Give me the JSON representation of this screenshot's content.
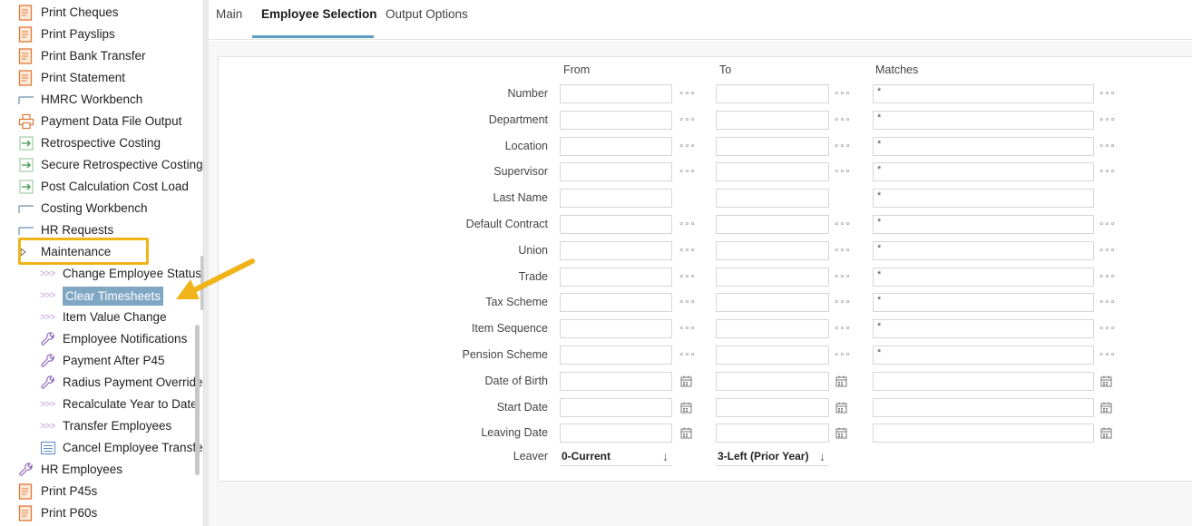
{
  "sidebar": {
    "items": [
      {
        "label": "Print Cheques",
        "icon": "document-icon"
      },
      {
        "label": "Print Payslips",
        "icon": "document-icon"
      },
      {
        "label": "Print Bank Transfer",
        "icon": "document-icon"
      },
      {
        "label": "Print Statement",
        "icon": "document-icon"
      },
      {
        "label": "HMRC Workbench",
        "icon": "workbench-icon"
      },
      {
        "label": "Payment Data File Output",
        "icon": "printer-icon"
      },
      {
        "label": "Retrospective Costing",
        "icon": "arrow-right-icon"
      },
      {
        "label": "Secure Retrospective Costing",
        "icon": "arrow-right-icon"
      },
      {
        "label": "Post Calculation Cost Load",
        "icon": "arrow-right-icon"
      },
      {
        "label": "Costing Workbench",
        "icon": "workbench-icon"
      },
      {
        "label": "HR Requests",
        "icon": "workbench-icon"
      },
      {
        "label": "Maintenance",
        "icon": "expand-arrow-icon"
      },
      {
        "label": "Change Employee Status",
        "icon": "chevrons-icon"
      },
      {
        "label": "Clear Timesheets",
        "icon": "chevrons-icon"
      },
      {
        "label": "Item Value Change",
        "icon": "chevrons-icon"
      },
      {
        "label": "Employee Notifications",
        "icon": "wrench-icon"
      },
      {
        "label": "Payment After P45",
        "icon": "wrench-icon"
      },
      {
        "label": "Radius Payment Override",
        "icon": "wrench-icon"
      },
      {
        "label": "Recalculate Year to Date",
        "icon": "chevrons-icon"
      },
      {
        "label": "Transfer Employees",
        "icon": "chevrons-icon"
      },
      {
        "label": "Cancel Employee Transfer",
        "icon": "list-icon"
      },
      {
        "label": "HR Employees",
        "icon": "wrench-icon"
      },
      {
        "label": "Print P45s",
        "icon": "document-icon"
      },
      {
        "label": "Print P60s",
        "icon": "document-icon"
      }
    ],
    "chevrons": ">>>"
  },
  "tabs": [
    {
      "label": "Main"
    },
    {
      "label": "Employee Selection"
    },
    {
      "label": "Output Options"
    }
  ],
  "form": {
    "headers": {
      "from": "From",
      "to": "To",
      "matches": "Matches"
    },
    "rows": [
      {
        "label": "Number",
        "match": "*",
        "type": "lookup"
      },
      {
        "label": "Department",
        "match": "*",
        "type": "lookup"
      },
      {
        "label": "Location",
        "match": "*",
        "type": "lookup"
      },
      {
        "label": "Supervisor",
        "match": "*",
        "type": "lookup"
      },
      {
        "label": "Last Name",
        "match": "*",
        "type": "text"
      },
      {
        "label": "Default Contract",
        "match": "*",
        "type": "lookup"
      },
      {
        "label": "Union",
        "match": "*",
        "type": "lookup"
      },
      {
        "label": "Trade",
        "match": "*",
        "type": "lookup"
      },
      {
        "label": "Tax Scheme",
        "match": "*",
        "type": "lookup"
      },
      {
        "label": "Item Sequence",
        "match": "*",
        "type": "lookup"
      },
      {
        "label": "Pension Scheme",
        "match": "*",
        "type": "lookup"
      },
      {
        "label": "Date of Birth",
        "match": "",
        "type": "date"
      },
      {
        "label": "Start Date",
        "match": "",
        "type": "date"
      },
      {
        "label": "Leaving Date",
        "match": "",
        "type": "date"
      }
    ],
    "leaver": {
      "label": "Leaver",
      "from": "0-Current",
      "to": "3-Left (Prior Year)"
    },
    "lookup_glyph": "∘∘∘",
    "select_glyph": "↓"
  },
  "colors": {
    "highlight": "#f0b41a",
    "selected_bg": "#7fa7c4",
    "tab_underline": "#5b9cc0"
  }
}
